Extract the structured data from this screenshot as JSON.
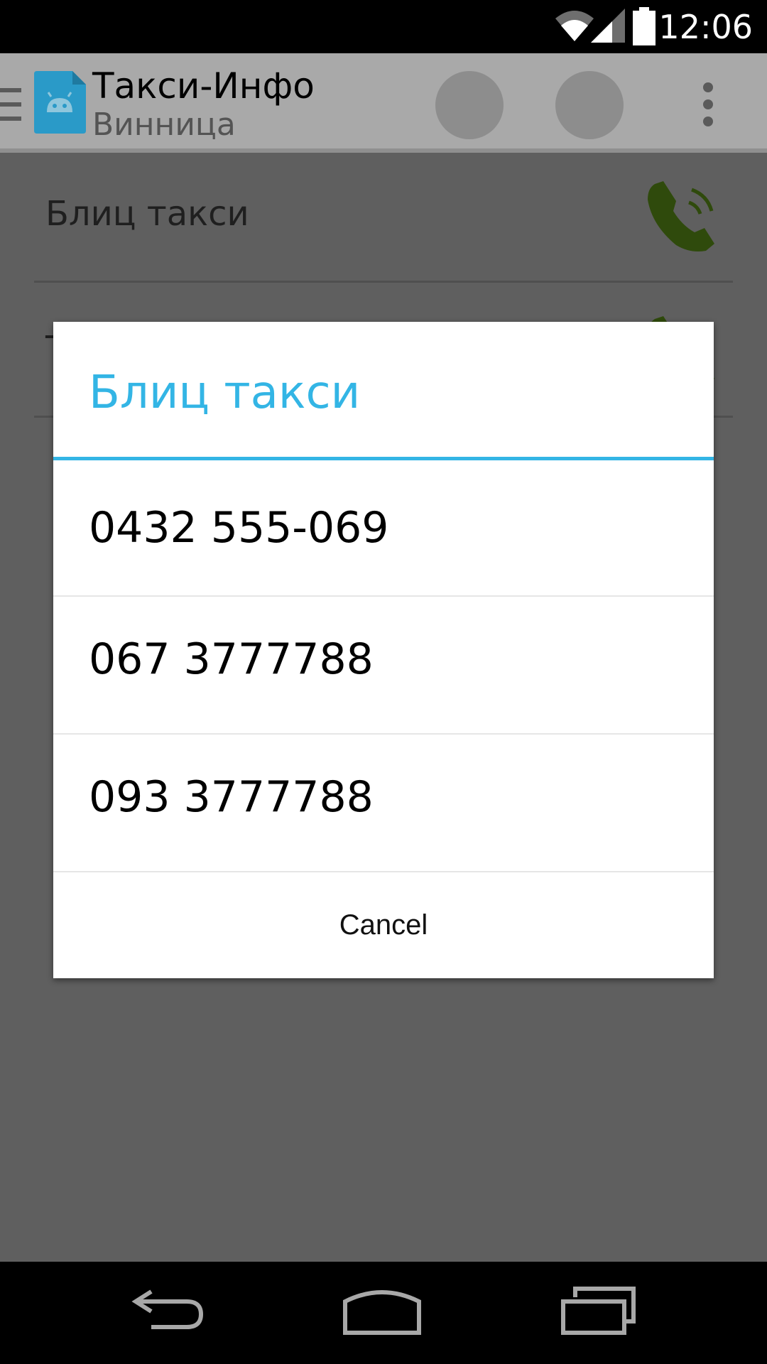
{
  "status_bar": {
    "time": "12:06",
    "icons": [
      "wifi-icon",
      "signal-icon",
      "battery-icon"
    ]
  },
  "action_bar": {
    "title": "Такси-Инфо",
    "subtitle": "Винница",
    "icons": [
      "drawer-icon",
      "android-app-icon",
      "action-button",
      "action-button",
      "overflow-menu-icon"
    ]
  },
  "list": {
    "items": [
      {
        "label": "Блиц такси",
        "icon": "phone-call-icon"
      },
      {
        "label": "Т",
        "icon": "phone-call-icon"
      }
    ]
  },
  "dialog": {
    "title": "Блиц такси",
    "phones": [
      "0432 555-069",
      "067 3777788",
      "093 3777788"
    ],
    "cancel_label": "Cancel"
  },
  "nav_bar": {
    "icons": [
      "back-icon",
      "home-icon",
      "recents-icon"
    ]
  },
  "colors": {
    "accent": "#33b5e5",
    "call_icon": "#2f4a0c",
    "scrim_background": "#5f5f5f"
  }
}
